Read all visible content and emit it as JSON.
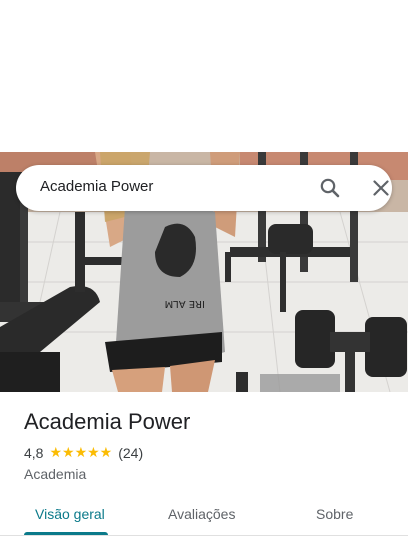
{
  "search": {
    "query": "Academia Power"
  },
  "place": {
    "title": "Academia Power",
    "rating": "4,8",
    "stars": "★★★★★",
    "review_count": "(24)",
    "category": "Academia"
  },
  "tabs": [
    {
      "label": "Visão geral",
      "active": true
    },
    {
      "label": "Avaliações",
      "active": false
    },
    {
      "label": "Sobre",
      "active": false
    }
  ],
  "icons": {
    "search": "search-icon",
    "close": "close-icon",
    "star": "star-icon"
  },
  "colors": {
    "accent": "#0b7a8a",
    "star": "#fbbc04"
  }
}
